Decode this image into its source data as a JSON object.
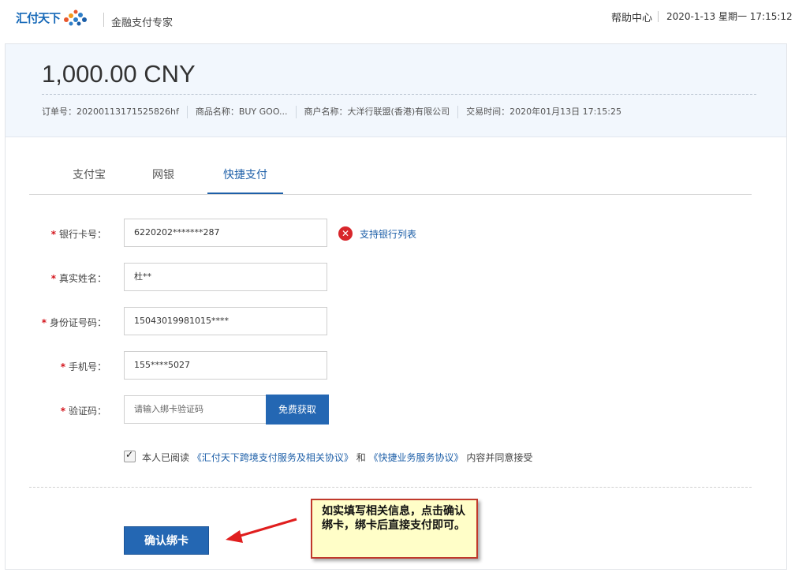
{
  "header": {
    "logo_text": "汇付天下",
    "slogan": "金融支付专家",
    "help": "帮助中心",
    "date": "2020-1-13",
    "weekday": "星期一",
    "time": "17:15:12"
  },
  "order": {
    "amount": "1,000.00 CNY",
    "order_no": "订单号：20200113171525826hf",
    "product": "商品名称：BUY GOO...",
    "merchant": "商户名称：大洋行联盟(香港)有限公司",
    "trade_time": "交易时间：2020年01月13日 17:15:25"
  },
  "tabs": [
    {
      "label": "支付宝",
      "active": false
    },
    {
      "label": "网银",
      "active": false
    },
    {
      "label": "快捷支付",
      "active": true
    }
  ],
  "form": {
    "required_mark": "*",
    "card": {
      "label": "银行卡号：",
      "value": "6220202*******287"
    },
    "name": {
      "label": "真实姓名：",
      "value": "杜**"
    },
    "id_no": {
      "label": "身份证号码：",
      "value": "15043019981015****"
    },
    "phone": {
      "label": "手机号：",
      "value": "155****5027"
    },
    "code": {
      "label": "验证码：",
      "placeholder": "请输入绑卡验证码"
    },
    "error_icon": "close-icon",
    "bank_list_link": "支持银行列表",
    "sms_button": "免费获取"
  },
  "agreement": {
    "checked": true,
    "prefix": "本人已阅读",
    "link1": "《汇付天下跨境支付服务及相关协议》",
    "and": "和",
    "link2": "《快捷业务服务协议》",
    "suffix": "内容并同意接受"
  },
  "confirm_button": "确认绑卡",
  "annotation": {
    "text": "如实填写相关信息，点击确认绑卡，绑卡后直接支付即可。"
  },
  "colors": {
    "primary": "#2467b3",
    "link": "#1d5fa8",
    "required": "#d4141c",
    "callout_border": "#c0392b",
    "callout_bg": "#fffec8"
  }
}
